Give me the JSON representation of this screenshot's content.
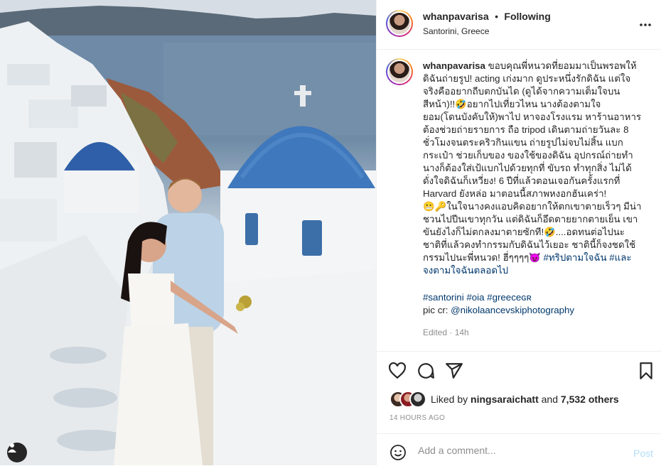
{
  "post": {
    "username": "whanpavarisa",
    "separator": "•",
    "follow_status": "Following",
    "location": "Santorini, Greece",
    "more_icon": "more-horizontal-icon",
    "caption_lines": [
      "ขอบคุณพี่หนวดที่ยอมมาเป็นพรอพให้",
      "ดิฉันถ่ายรูป! acting เก่งมาก ดูประหนึ่งรักดิฉัน แต่ใจ",
      "จริงคืออยากถีบตกบันได (ดูได้จากความเต็มใจบน",
      "สีหน้า)!!🤣อยากไปเที่ยวไหน นางต้องตามใจ",
      "ยอม(โดนบังคับให้)พาไป หาจองโรงแรม หาร้านอาหาร",
      "ต้องช่วยถ่ายรายการ ถือ tripod เดินตามถ่ายวันละ 8",
      "ชั่วโมงจนตระคริวกินแขน ถ่ายรูปไม่จบไม่สิ้น แบก",
      "กระเป๋า ช่วยเก็บของ ของใช้ของดิฉัน อุปกรณ์ถ่ายทำ",
      "นางก็ต้องใส่เป้แบกไปด้วยทุกที่ ขับรถ ทำทุกสิ่ง ไม่ได้",
      "ดั่งใจดิฉันก็เหวี่ยง! 6 ปีที่แล้วตอนเจอกันครั้งแรกที่",
      "Harvard ยังหล่อ มาตอนนี้สภาพหงอกฮันเคร่า!",
      "😬🔑ในใจนางคงแอบคิดอยากให้ตกเขาตายเร็วๆ มีน่า",
      "ชวนไปปีนเขาทุกวัน แต่ดิฉันก็อึดตายยากตายเย็น เขา",
      "ขันยังไงก็ไม่ตกลงมาตายซักที!🤣....อดทนต่อไปนะ",
      "ชาติที่แล้วคงทำกรรมกับดิฉันไว้เยอะ ชาตินี้ก็จงชดใช้",
      "กรรมไปนะพี่หนวด! ฮี่ๆๆๆๆ😈"
    ],
    "caption_tag_inline": "#ทริปตามใจฉัน #และ",
    "caption_tag_line2": "จงตามใจฉันตลอดไป",
    "hashtags": "#santorini #oia #greeceɢʀ",
    "credit_prefix": "pic cr: ",
    "credit_handle": "@nikolaancevskiphotography",
    "edited": "Edited · 14h",
    "likes": {
      "prefix": "Liked by ",
      "user": "ningsaraichatt",
      "middle": " and ",
      "count": "7,532 others"
    },
    "time_ago": "14 HOURS AGO",
    "comment": {
      "placeholder": "Add a comment...",
      "post_label": "Post"
    },
    "icons": [
      "heart-icon",
      "comment-icon",
      "share-icon",
      "bookmark-icon",
      "emoji-icon",
      "user-tag-icon"
    ],
    "colors": {
      "link": "#00376b",
      "muted": "#8e8e8e",
      "post_disabled": "#b2dffc"
    }
  }
}
